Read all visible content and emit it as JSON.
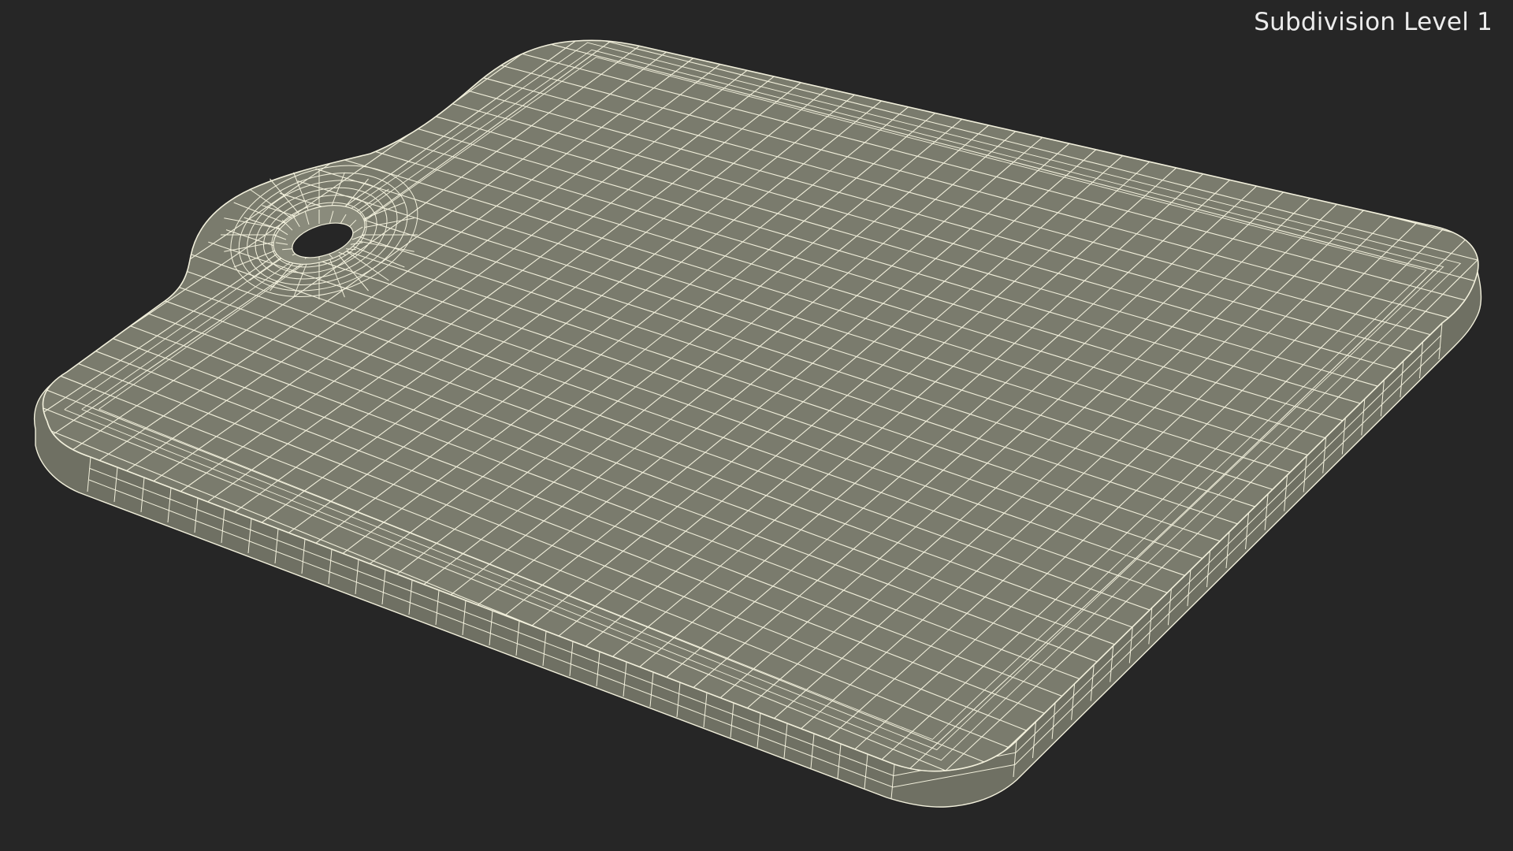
{
  "viewport": {
    "label": "Subdivision Level 1",
    "background_color": "#262626",
    "surface_color": "#7a7b6d",
    "wire_color": "#f2f0dc"
  },
  "object": {
    "name": "cutting-board-wireframe",
    "has_hanging_hole": true
  }
}
